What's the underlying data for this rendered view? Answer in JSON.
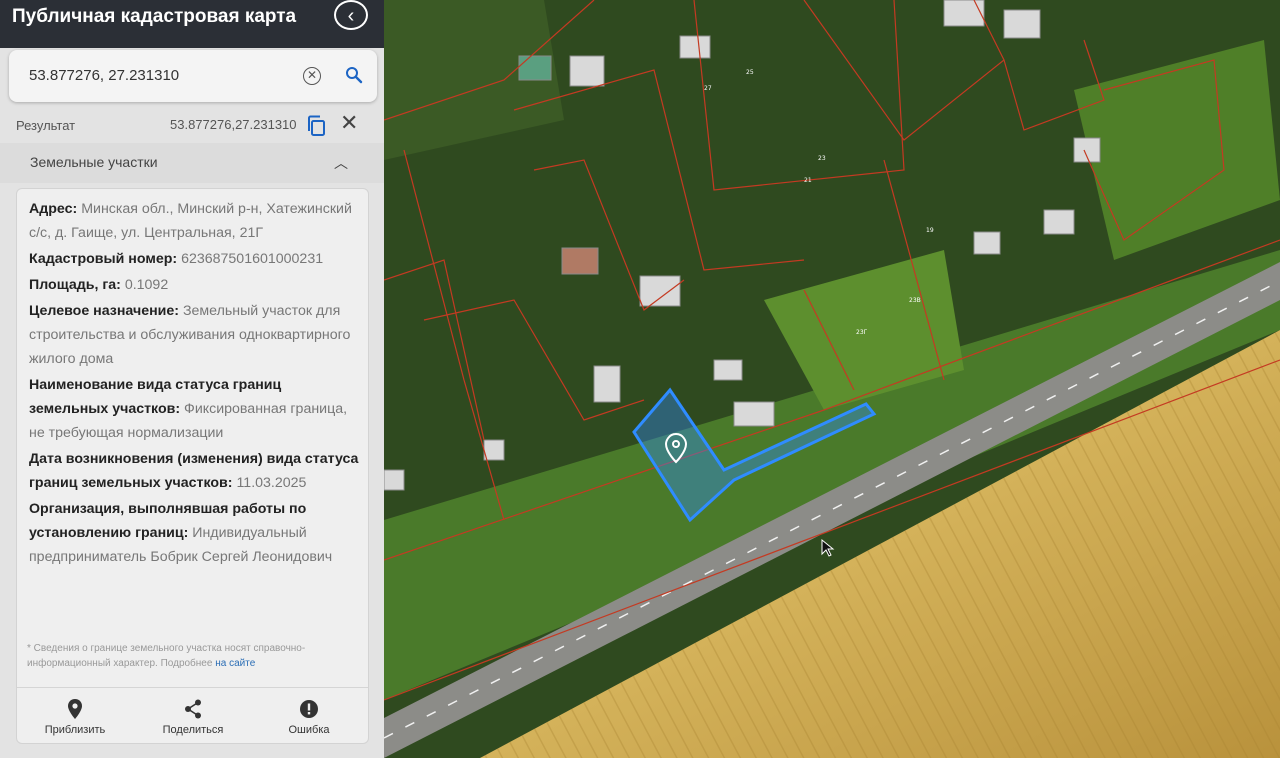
{
  "header": {
    "title": "Публичная кадастровая карта",
    "back_icon": "chevron-left-icon"
  },
  "search": {
    "value": "53.877276, 27.231310",
    "clear_icon": "clear-circle-icon",
    "search_icon": "search-icon"
  },
  "result": {
    "label": "Результат",
    "coords": "53.877276,27.231310",
    "copy_icon": "copy-icon",
    "close_icon": "close-icon"
  },
  "section": {
    "title": "Земельные участки",
    "toggle_icon": "chevron-up-icon"
  },
  "parcel": {
    "address_label": "Адрес:",
    "address_value": "Минская обл., Минский р-н, Хатежинский с/с, д. Гаище, ул. Центральная, 21Г",
    "cadastral_label": "Кадастровый номер:",
    "cadastral_value": "623687501601000231",
    "area_label": "Площадь, га:",
    "area_value": "0.1092",
    "purpose_label": "Целевое назначение:",
    "purpose_value": "Земельный участок для строительства и обслуживания одноквартирного жилого дома",
    "boundary_status_label": "Наименование вида статуса границ земельных участков:",
    "boundary_status_value": "Фиксированная граница, не требующая нормализации",
    "status_date_label": "Дата возникновения (изменения) вида статуса границ земельных участков:",
    "status_date_value": "11.03.2025",
    "organization_label": "Организация, выполнявшая работы по установлению границ:",
    "organization_value": "Индивидуальный предприниматель Бобрик Сергей Леонидович"
  },
  "note": {
    "text": "* Сведения о границе земельного участка носят справочно-информационный характер. Подробнее",
    "link": "на сайте"
  },
  "actions": [
    {
      "label": "Приблизить",
      "icon": "location-pin-icon"
    },
    {
      "label": "Поделиться",
      "icon": "share-icon"
    },
    {
      "label": "Ошибка",
      "icon": "error-icon"
    }
  ],
  "colors": {
    "header_bg": "#2b2f36",
    "panel_bg": "#e3e3e3",
    "link": "#2a6db5",
    "parcel_outline": "#2f8cff",
    "boundary_lines": "#c43a22",
    "field": "#c9a345",
    "road": "#8c8c88"
  },
  "map": {
    "marker_icon": "map-marker-icon",
    "cursor_icon": "mouse-cursor-icon"
  }
}
